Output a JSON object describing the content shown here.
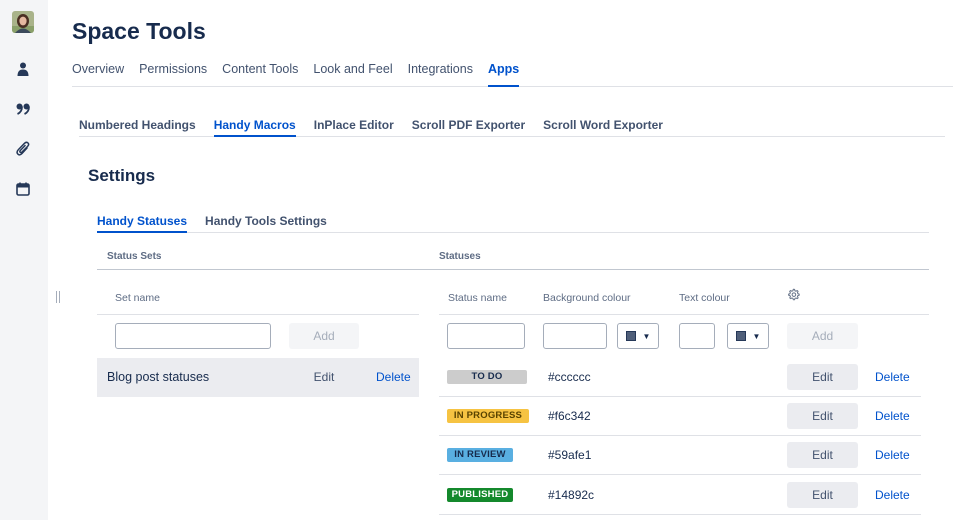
{
  "space": {
    "title": "Space Tools"
  },
  "top_tabs": [
    {
      "label": "Overview"
    },
    {
      "label": "Permissions"
    },
    {
      "label": "Content Tools"
    },
    {
      "label": "Look and Feel"
    },
    {
      "label": "Integrations"
    },
    {
      "label": "Apps",
      "active": true
    }
  ],
  "sub_tabs": [
    {
      "label": "Numbered Headings"
    },
    {
      "label": "Handy Macros",
      "active": true
    },
    {
      "label": "InPlace Editor"
    },
    {
      "label": "Scroll PDF Exporter"
    },
    {
      "label": "Scroll Word Exporter"
    }
  ],
  "settings": {
    "title": "Settings",
    "tabs": [
      {
        "label": "Handy Statuses",
        "active": true
      },
      {
        "label": "Handy Tools Settings"
      }
    ]
  },
  "status_sets": {
    "section_label": "Status Sets",
    "column_set_name": "Set name",
    "new_name_value": "",
    "add_label": "Add",
    "rows": [
      {
        "name": "Blog post statuses",
        "edit_label": "Edit",
        "delete_label": "Delete"
      }
    ]
  },
  "statuses": {
    "section_label": "Statuses",
    "columns": {
      "status_name": "Status name",
      "background_colour": "Background colour",
      "text_colour": "Text colour"
    },
    "settings_icon": "gear-icon",
    "new_row": {
      "name_value": "",
      "background_value": "",
      "text_value": "",
      "add_label": "Add"
    },
    "rows": [
      {
        "name": "TO DO",
        "background": "#cccccc",
        "text_color": "#172b4d",
        "edit_label": "Edit",
        "delete_label": "Delete"
      },
      {
        "name": "IN PROGRESS",
        "background": "#f6c342",
        "text_color": "#594300",
        "edit_label": "Edit",
        "delete_label": "Delete"
      },
      {
        "name": "IN REVIEW",
        "background": "#59afe1",
        "text_color": "#172b4d",
        "edit_label": "Edit",
        "delete_label": "Delete"
      },
      {
        "name": "PUBLISHED",
        "background": "#14892c",
        "text_color": "#ffffff",
        "edit_label": "Edit",
        "delete_label": "Delete"
      }
    ]
  },
  "rail_icons": [
    "avatar",
    "person-icon",
    "quote-icon",
    "paperclip-icon",
    "calendar-icon"
  ],
  "colors": {
    "accent": "#0052cc",
    "text": "#172b4d",
    "muted": "#5e6c84",
    "rail_bg": "#f4f5f7"
  }
}
